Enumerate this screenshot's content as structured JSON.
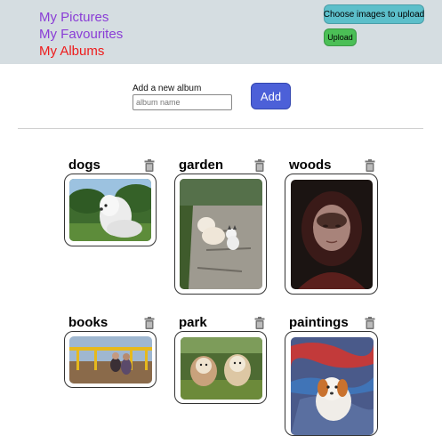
{
  "nav": {
    "my_pictures": "My Pictures",
    "my_favourites": "My Favourites",
    "my_albums": "My Albums"
  },
  "header_actions": {
    "choose_images": "Choose images to upload",
    "upload": "Upload"
  },
  "add_album": {
    "label": "Add a new album",
    "placeholder": "album name",
    "button": "Add"
  },
  "albums": [
    {
      "title": "dogs",
      "photo": "white dog on grass"
    },
    {
      "title": "garden",
      "photo": "dog and cat on stone path"
    },
    {
      "title": "woods",
      "photo": "woman in red hood"
    },
    {
      "title": "books",
      "photo": "two people by yellow railing"
    },
    {
      "title": "park",
      "photo": "two fluffy dogs in park"
    },
    {
      "title": "paintings",
      "photo": "painting of a puppy"
    }
  ],
  "colors": {
    "header_bg": "#d5dde1",
    "nav_purple": "#8a3dd6",
    "nav_active": "#ee1c1c",
    "choose_btn": "#5cbfca",
    "upload_btn": "#4bbf56",
    "add_btn": "#4c60d8"
  },
  "icons": {
    "delete": "trash-icon"
  }
}
